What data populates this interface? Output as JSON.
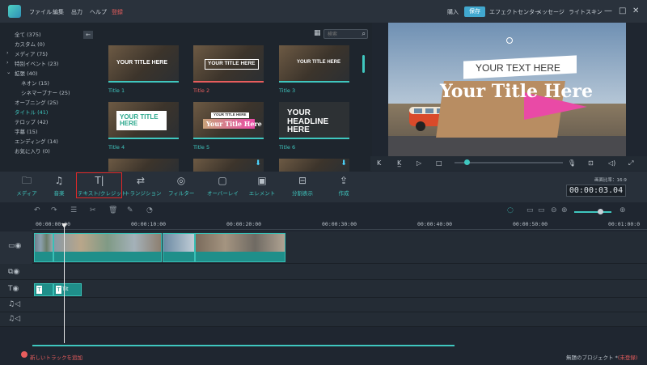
{
  "menubar": {
    "items": [
      "ファイル",
      "編集",
      "出力",
      "ヘルプ",
      "登録"
    ],
    "right": [
      "購入",
      "保存",
      "エフェクトセンター",
      "メッセージ",
      "ライトスキン"
    ],
    "window_controls": [
      "minimize-icon",
      "restore-icon",
      "close-icon"
    ]
  },
  "library": {
    "categories": [
      {
        "label": "全て (375)"
      },
      {
        "label": "カスタム (0)"
      },
      {
        "label": "メディア (75)",
        "arrow": "›"
      },
      {
        "label": "特別イベント (23)",
        "arrow": "›"
      },
      {
        "label": "拡張 (40)",
        "arrow": "⌄"
      },
      {
        "label": "ネオン (15)",
        "indent": true
      },
      {
        "label": "シネマーブナー (25)",
        "indent": true
      },
      {
        "label": "オープニング (25)"
      },
      {
        "label": "タイトル (41)",
        "active": true
      },
      {
        "label": "テロップ (42)"
      },
      {
        "label": "字幕 (15)"
      },
      {
        "label": "エンディング (14)"
      },
      {
        "label": "お気に入り (0)"
      }
    ],
    "search_placeholder": "検索",
    "thumbnails": [
      {
        "label": "Title 1",
        "text": "YOUR TITLE HERE"
      },
      {
        "label": "Title 2",
        "text": "YOUR TITLE HERE",
        "selected": true
      },
      {
        "label": "Title 3",
        "text": "YOUR TITLE HERE"
      },
      {
        "label": "Title 4",
        "text": "YOUR TITLE HERE"
      },
      {
        "label": "Title 5",
        "text": "Your Title Here",
        "small": "YOUR TITLE HERE"
      },
      {
        "label": "Title 6",
        "text": "YOUR HEADLINE HERE"
      }
    ]
  },
  "preview": {
    "text_top": "YOUR TEXT HERE",
    "text_main": "Your Title Here",
    "controls": [
      "K",
      "K̲",
      "▷",
      "□"
    ]
  },
  "toolbar": {
    "tools": [
      {
        "label": "メディア",
        "icon": "folder-icon"
      },
      {
        "label": "音楽",
        "icon": "music-icon"
      },
      {
        "label": "テキスト/クレジット",
        "icon": "text-icon",
        "active": true
      },
      {
        "label": "トランジション",
        "icon": "transition-icon"
      },
      {
        "label": "フィルター",
        "icon": "filter-icon"
      },
      {
        "label": "オーバーレイ",
        "icon": "overlay-icon"
      },
      {
        "label": "エレメント",
        "icon": "element-icon"
      },
      {
        "label": "分割表示",
        "icon": "split-icon"
      },
      {
        "label": "作成",
        "icon": "export-icon"
      }
    ],
    "ratio_label": "画面比率：16:9",
    "timecode": "00:00:03.04"
  },
  "timeline": {
    "ticks": [
      "00:00:00:00",
      "00:00:10:00",
      "00:00:20:00",
      "00:00:30:00",
      "00:00:40:00",
      "00:00:50:00",
      "00:01:00:0"
    ],
    "text_clips": [
      "T",
      "Tit",
      "T"
    ],
    "add_track": "新しいトラックを追加",
    "project_name": "無題のプロジェクト *",
    "unregistered": "(未登録)"
  },
  "colors": {
    "accent": "#3fc7bf",
    "highlight": "#e02828",
    "save": "#41a8cf"
  }
}
